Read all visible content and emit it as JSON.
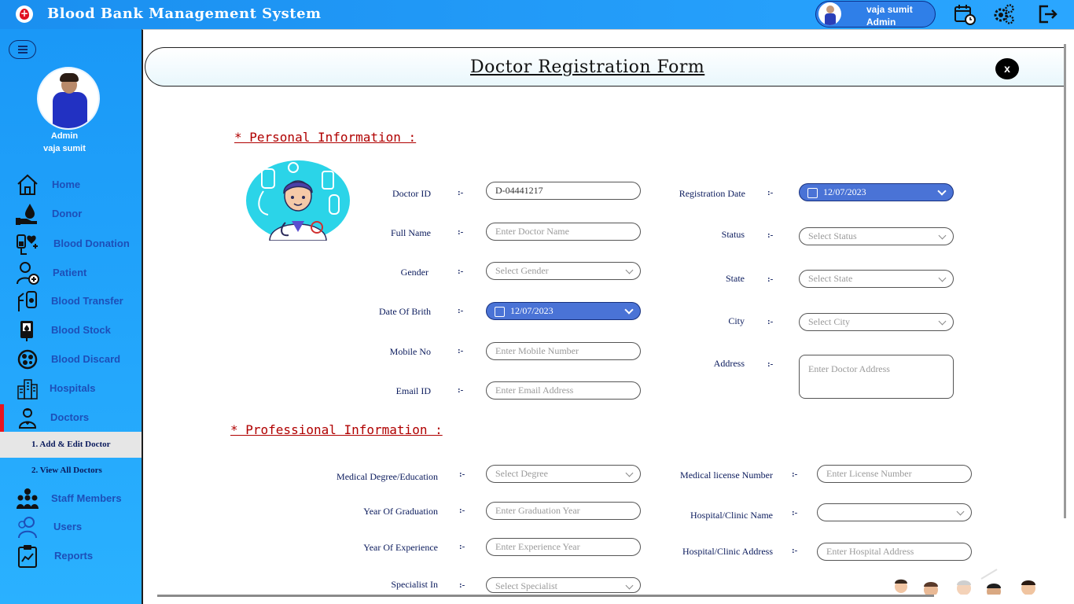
{
  "app": {
    "title": "Blood Bank Management System",
    "logo_glyph": "+"
  },
  "header": {
    "user_name": "vaja sumit",
    "user_role": "Admin",
    "icons": [
      "calendar-clock-icon",
      "settings-gears-icon",
      "logout-icon"
    ]
  },
  "sidebar": {
    "profile_role": "Admin",
    "profile_name": "vaja sumit",
    "items": [
      {
        "label": "Home",
        "icon": "home-icon"
      },
      {
        "label": "Donor",
        "icon": "donor-blood-drop-icon"
      },
      {
        "label": "Blood Donation",
        "icon": "blood-donation-icon"
      },
      {
        "label": "Patient",
        "icon": "patient-icon"
      },
      {
        "label": "Blood Transfer",
        "icon": "blood-transfer-icon"
      },
      {
        "label": "Blood Stock",
        "icon": "blood-stock-icon"
      },
      {
        "label": "Blood Discard",
        "icon": "blood-discard-icon"
      },
      {
        "label": "Hospitals",
        "icon": "hospital-building-icon"
      },
      {
        "label": "Doctors",
        "icon": "doctor-icon"
      },
      {
        "label": "Staff Members",
        "icon": "staff-members-icon"
      },
      {
        "label": "Users",
        "icon": "users-icon"
      },
      {
        "label": "Reports",
        "icon": "reports-clipboard-icon"
      }
    ],
    "sub_items": [
      {
        "label": "1.  Add & Edit Doctor"
      },
      {
        "label": "2.  View All Doctors"
      }
    ]
  },
  "form": {
    "title": "Doctor  Registration Form",
    "close_label": "x",
    "separator": ":-",
    "personal_section": "* Personal Information  :",
    "professional_section": "* Professional Information  :",
    "doctor_id": {
      "label": "Doctor  ID",
      "value": "D-04441217"
    },
    "full_name": {
      "label": "Full Name",
      "placeholder": "Enter Doctor Name"
    },
    "gender": {
      "label": "Gender",
      "placeholder": "Select Gender"
    },
    "dob": {
      "label": "Date Of Brith",
      "value": "12/07/2023"
    },
    "mobile": {
      "label": "Mobile No",
      "placeholder": "Enter Mobile Number"
    },
    "email": {
      "label": "Email ID",
      "placeholder": "Enter Email Address"
    },
    "reg_date": {
      "label": "Registration Date",
      "value": "12/07/2023"
    },
    "status": {
      "label": "Status",
      "placeholder": "Select Status"
    },
    "state": {
      "label": "State",
      "placeholder": "Select State"
    },
    "city": {
      "label": "City",
      "placeholder": "Select City"
    },
    "address": {
      "label": "Address",
      "placeholder": "Enter Doctor Address"
    },
    "degree": {
      "label": "Medical Degree/Education",
      "placeholder": "Select Degree"
    },
    "grad_year": {
      "label": "Year Of Graduation",
      "placeholder": "Enter Graduation Year"
    },
    "exp_year": {
      "label": "Year Of Experience",
      "placeholder": "Enter Experience Year"
    },
    "specialist": {
      "label": "Specialist In",
      "placeholder": "Select Specialist"
    },
    "license": {
      "label": "Medical license Number",
      "placeholder": "Enter License Number"
    },
    "hospital_name": {
      "label": "Hospital/Clinic Name",
      "placeholder": ""
    },
    "hospital_address": {
      "label": "Hospital/Clinic Address",
      "placeholder": "Enter Hospital Address"
    }
  },
  "colors": {
    "accent_blue": "#1a98f7",
    "date_field": "#4a73d6",
    "section_red": "#b00000",
    "active_marker": "#e8141f"
  }
}
